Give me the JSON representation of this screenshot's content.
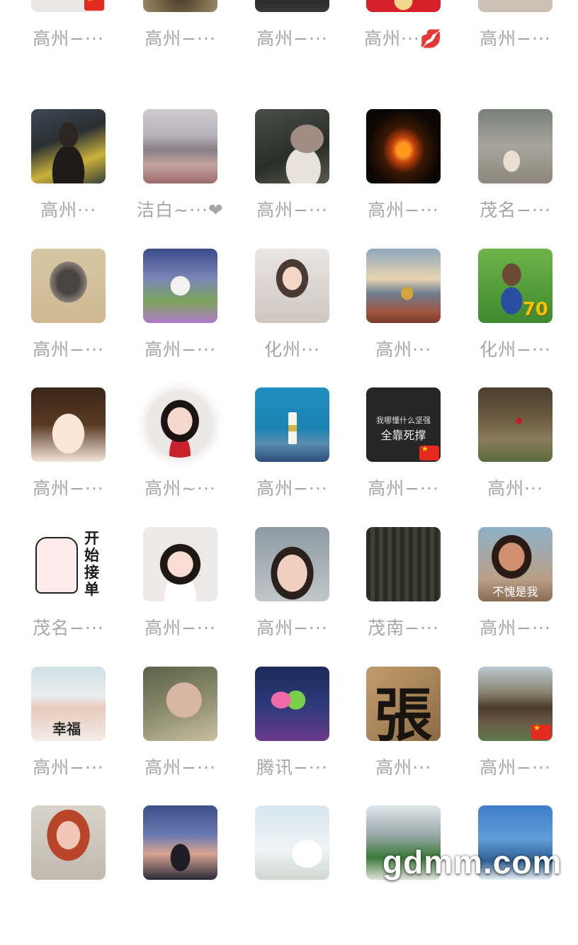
{
  "contacts": [
    {
      "label": "高州−···",
      "flag": true
    },
    {
      "label": "高州−···",
      "flag": false
    },
    {
      "label": "高州−···",
      "flag": false
    },
    {
      "label": "高州···💋",
      "flag": false
    },
    {
      "label": "高州−···",
      "flag": false
    },
    {
      "label": "高州···",
      "flag": false
    },
    {
      "label": "洁白~···❤",
      "flag": false
    },
    {
      "label": "高州−···",
      "flag": false
    },
    {
      "label": "高州−···",
      "flag": false
    },
    {
      "label": "茂名−···",
      "flag": false
    },
    {
      "label": "高州−···",
      "flag": false
    },
    {
      "label": "高州−···",
      "flag": false
    },
    {
      "label": "化州···",
      "flag": false
    },
    {
      "label": "高州···",
      "flag": false
    },
    {
      "label": "化州−···",
      "flag": false
    },
    {
      "label": "高州−···",
      "flag": false
    },
    {
      "label": "高州~···",
      "flag": false
    },
    {
      "label": "高州−···",
      "flag": false
    },
    {
      "label": "高州−···",
      "flag": true
    },
    {
      "label": "高州···",
      "flag": false
    },
    {
      "label": "茂名−···",
      "flag": false
    },
    {
      "label": "高州−···",
      "flag": false
    },
    {
      "label": "高州−···",
      "flag": false
    },
    {
      "label": "茂南−···",
      "flag": false
    },
    {
      "label": "高州−···",
      "flag": false
    },
    {
      "label": "高州−···",
      "flag": false
    },
    {
      "label": "高州−···",
      "flag": false
    },
    {
      "label": "腾讯−···",
      "flag": false
    },
    {
      "label": "高州···",
      "flag": false
    },
    {
      "label": "高州−···",
      "flag": true
    },
    {
      "label": "",
      "flag": false
    },
    {
      "label": "",
      "flag": false
    },
    {
      "label": "",
      "flag": false
    },
    {
      "label": "",
      "flag": false
    },
    {
      "label": "",
      "flag": false
    }
  ],
  "avatar_texts": {
    "slogan_line1": "我哪懂什么坚强",
    "slogan_line2": "全靠死撑",
    "neza_caption": "不愧是我",
    "ad_title": "开始接单",
    "calligraphy": "張",
    "badge_number": "70",
    "couple_caption": "幸福"
  },
  "watermark": "gdmm.com"
}
